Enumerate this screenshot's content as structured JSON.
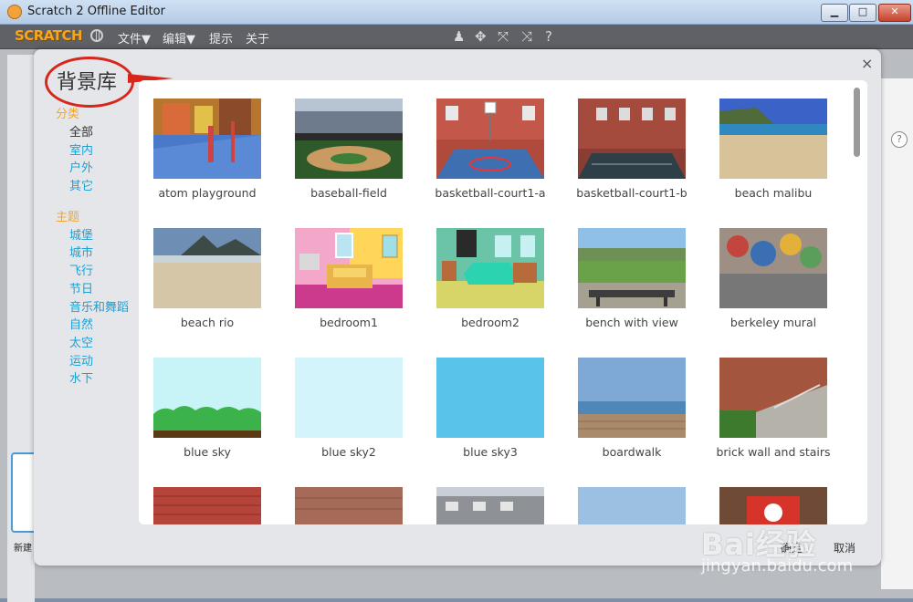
{
  "window": {
    "title": "Scratch 2 Offline Editor",
    "min_label": "▁",
    "max_label": "□",
    "close_label": "✕"
  },
  "menubar": {
    "logo": "SCRATCH",
    "items": [
      "文件▼",
      "编辑▼",
      "提示",
      "关于"
    ],
    "tools": [
      "♟",
      "✥",
      "⤧",
      "⤨",
      "?"
    ]
  },
  "dialog": {
    "title": "背景库",
    "close_label": "×",
    "category_heading": "分类",
    "categories": [
      "全部",
      "室内",
      "户外",
      "其它"
    ],
    "theme_heading": "主题",
    "themes": [
      "城堡",
      "城市",
      "飞行",
      "节日",
      "音乐和舞蹈",
      "自然",
      "太空",
      "运动",
      "水下"
    ],
    "ok_label": "确定",
    "cancel_label": "取消"
  },
  "backdrops": [
    {
      "name": "atom playground"
    },
    {
      "name": "baseball-field"
    },
    {
      "name": "basketball-court1-a"
    },
    {
      "name": "basketball-court1-b"
    },
    {
      "name": "beach malibu"
    },
    {
      "name": "beach rio"
    },
    {
      "name": "bedroom1"
    },
    {
      "name": "bedroom2"
    },
    {
      "name": "bench with view"
    },
    {
      "name": "berkeley mural"
    },
    {
      "name": "blue sky"
    },
    {
      "name": "blue sky2"
    },
    {
      "name": "blue sky3"
    },
    {
      "name": "boardwalk"
    },
    {
      "name": "brick wall and stairs"
    }
  ],
  "editor": {
    "new_sprite_label": "新建"
  },
  "watermark": {
    "brand": "Bai经验",
    "url": "jingyan.baidu.com"
  },
  "colors": {
    "category_heading": "#f4a52b",
    "category_link": "#1aa1d6",
    "annotation": "#d8261d"
  }
}
